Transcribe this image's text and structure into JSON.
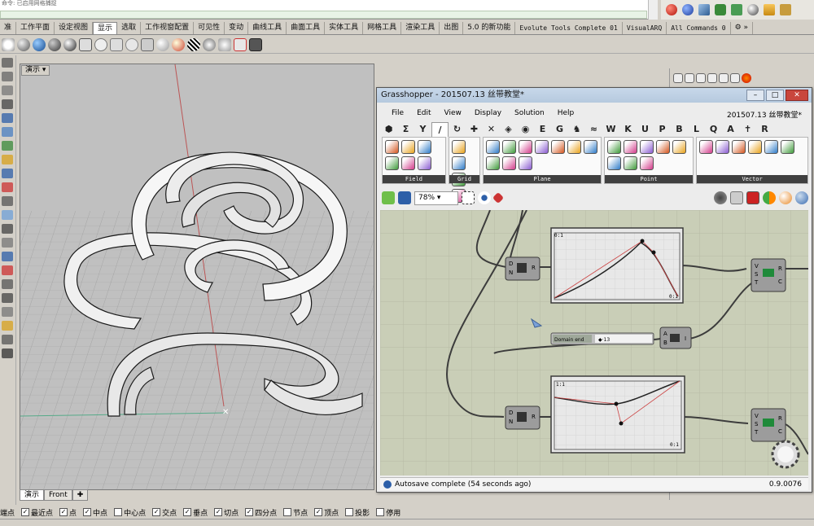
{
  "command": {
    "history_text": "命令: 已启用网格捕捉"
  },
  "tabs": [
    {
      "label": "准",
      "active": false
    },
    {
      "label": "工作平面",
      "active": false
    },
    {
      "label": "设定视图",
      "active": false
    },
    {
      "label": "显示",
      "active": true
    },
    {
      "label": "选取",
      "active": false
    },
    {
      "label": "工作视窗配置",
      "active": false
    },
    {
      "label": "可见性",
      "active": false
    },
    {
      "label": "变动",
      "active": false
    },
    {
      "label": "曲线工具",
      "active": false
    },
    {
      "label": "曲面工具",
      "active": false
    },
    {
      "label": "实体工具",
      "active": false
    },
    {
      "label": "网格工具",
      "active": false
    },
    {
      "label": "渲染工具",
      "active": false
    },
    {
      "label": "出图",
      "active": false
    },
    {
      "label": "5.0 的新功能",
      "active": false
    },
    {
      "label": "Evolute Tools Complete 01",
      "active": false,
      "mono": true
    },
    {
      "label": "VisualARQ",
      "active": false,
      "mono": true
    },
    {
      "label": "All Commands 0",
      "active": false,
      "mono": true
    }
  ],
  "viewport": {
    "label": "演示",
    "tabs": [
      "演示",
      "Front"
    ]
  },
  "grasshopper": {
    "title": "Grasshopper - 201507.13 丝带教堂*",
    "doc_name": "201507.13 丝带教堂*",
    "menu": [
      "File",
      "Edit",
      "View",
      "Display",
      "Solution",
      "Help"
    ],
    "categories": [
      "⬢",
      "Σ",
      "Y",
      "∕",
      "↻",
      "✚",
      "✕",
      "◈",
      "◉",
      "E",
      "G",
      "♞",
      "≈",
      "W",
      "K",
      "U",
      "P",
      "B",
      "L",
      "Q",
      "A",
      "✝",
      "R"
    ],
    "groups": [
      {
        "name": "Field",
        "cells": 6
      },
      {
        "name": "Grid",
        "cells": 4
      },
      {
        "name": "Plane",
        "cells": 10
      },
      {
        "name": "Point",
        "cells": 8
      },
      {
        "name": "Vector",
        "cells": 6
      }
    ],
    "zoom": "78%",
    "nodes": {
      "construct_1": {
        "in1": "D",
        "in2": "N",
        "out": "R"
      },
      "construct_2": {
        "in1": "D",
        "in2": "N",
        "out": "R"
      },
      "graph1_label": "0:1",
      "graph1_corner": "0:1",
      "graph2_label": "1:1",
      "graph2_corner": "0:1",
      "vec_1": {
        "in": [
          "V",
          "S",
          "T"
        ],
        "out": [
          "R",
          "C"
        ]
      },
      "vec_2": {
        "in": [
          "V",
          "S",
          "T"
        ],
        "out": [
          "R",
          "C"
        ]
      },
      "slider_label": "Domain end",
      "slider_value": "◆·13",
      "ab_node": {
        "in": [
          "A",
          "B"
        ],
        "out": "I"
      }
    },
    "status": "Autosave complete (54 seconds ago)",
    "version": "0.9.0076"
  },
  "snaps": [
    {
      "label": "端点",
      "checked": true,
      "nobox": true
    },
    {
      "label": "最近点",
      "checked": true
    },
    {
      "label": "点",
      "checked": true
    },
    {
      "label": "中点",
      "checked": true
    },
    {
      "label": "中心点",
      "checked": false
    },
    {
      "label": "交点",
      "checked": true
    },
    {
      "label": "垂点",
      "checked": true
    },
    {
      "label": "切点",
      "checked": true
    },
    {
      "label": "四分点",
      "checked": true
    },
    {
      "label": "节点",
      "checked": false
    },
    {
      "label": "顶点",
      "checked": true
    },
    {
      "label": "投影",
      "checked": false
    },
    {
      "label": "停用",
      "checked": false
    }
  ],
  "colors": {
    "gh_canvas": "#c9ceb7",
    "node": "#9c9c9c",
    "wire": "#404040"
  }
}
